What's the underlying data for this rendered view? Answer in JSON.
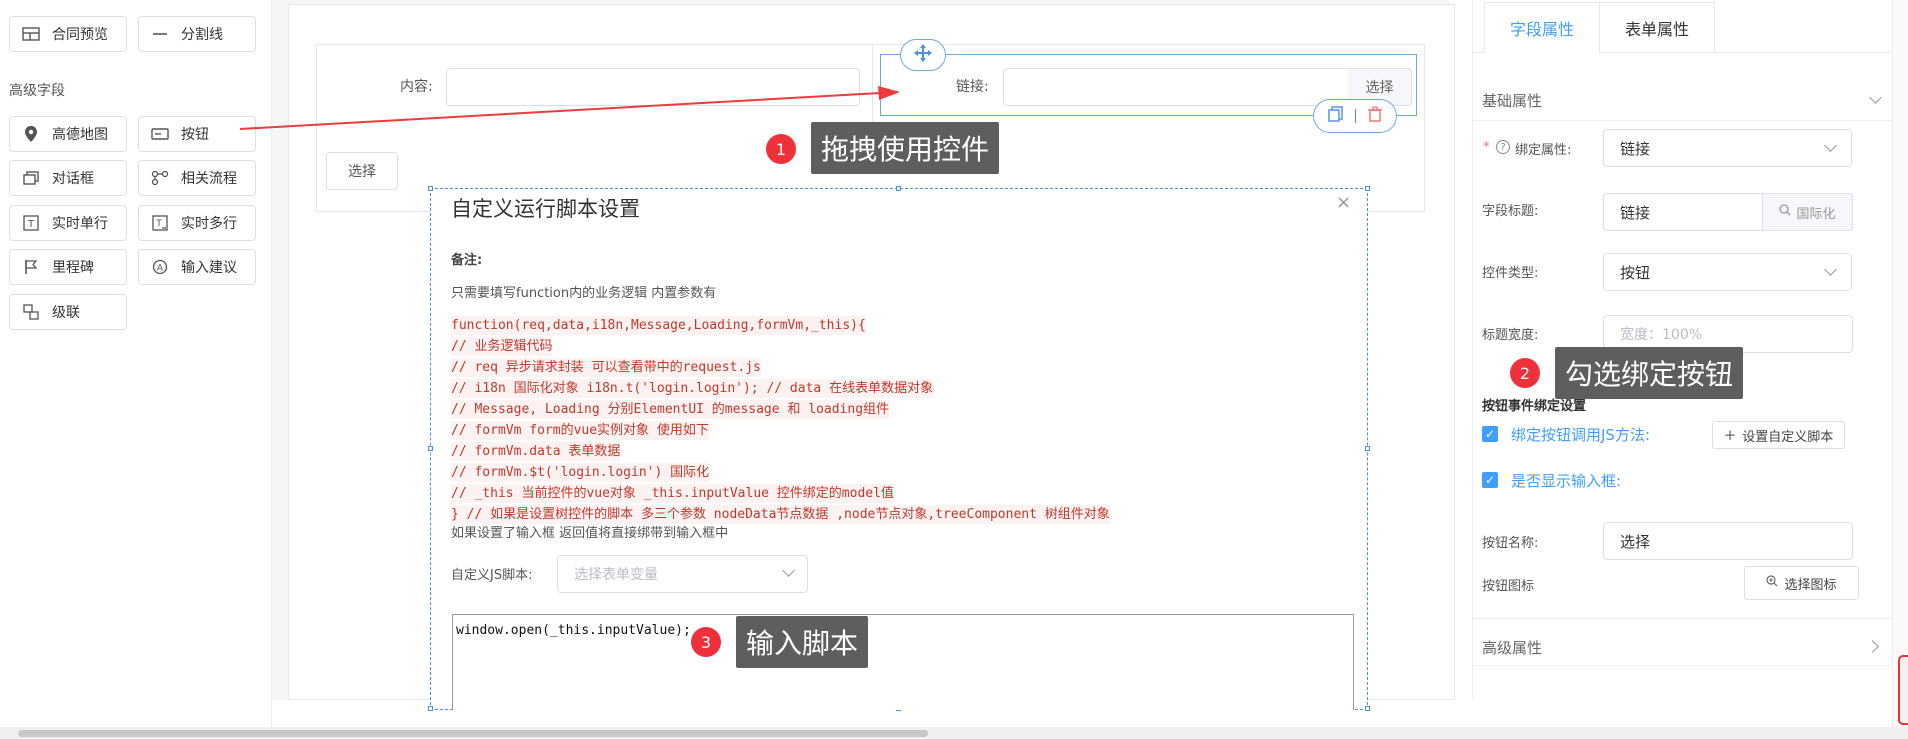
{
  "sidebar": {
    "items_top": [
      {
        "label": "合同预览",
        "icon": "table-icon"
      },
      {
        "label": "分割线",
        "icon": "divider-icon"
      }
    ],
    "section_title": "高级字段",
    "items": [
      {
        "label": "高德地图",
        "icon": "map-pin-icon"
      },
      {
        "label": "按钮",
        "icon": "button-icon"
      },
      {
        "label": "对话框",
        "icon": "dialog-icon"
      },
      {
        "label": "相关流程",
        "icon": "flow-icon"
      },
      {
        "label": "实时单行",
        "icon": "text-single-icon"
      },
      {
        "label": "实时多行",
        "icon": "text-multi-icon"
      },
      {
        "label": "里程碑",
        "icon": "flag-icon"
      },
      {
        "label": "输入建议",
        "icon": "suggest-icon"
      },
      {
        "label": "级联",
        "icon": "cascade-icon"
      }
    ]
  },
  "canvas": {
    "content_label": "内容:",
    "link_label": "链接:",
    "select_btn": "选择",
    "select_btn2": "选择"
  },
  "dialog": {
    "title": "自定义运行脚本设置",
    "close": "×",
    "note_label": "备注:",
    "note_text": "只需要填写function内的业务逻辑 内置参数有",
    "code_lines": [
      "function(req,data,i18n,Message,Loading,formVm,_this){",
      "// 业务逻辑代码",
      "// req 异步请求封装 可以查看带中的request.js",
      "// i18n 国际化对象 i18n.t('login.login'); // data 在线表单数据对象",
      "// Message, Loading 分别ElementUI 的message 和 loading组件",
      "// formVm form的vue实例对象 使用如下",
      "// formVm.data 表单数据",
      "// formVm.$t('login.login') 国际化",
      "// _this 当前控件的vue对象 _this.inputValue 控件绑定的model值",
      "} // 如果是设置树控件的脚本 多三个参数 nodeData节点数据 ,node节点对象,treeComponent 树组件对象"
    ],
    "after_code": "如果设置了输入框 返回值将直接绑带到输入框中",
    "js_label": "自定义JS脚本:",
    "js_placeholder": "选择表单变量",
    "script": "window.open(_this.inputValue);"
  },
  "annotations": [
    {
      "num": "1",
      "text": "拖拽使用控件"
    },
    {
      "num": "2",
      "text": "勾选绑定按钮"
    },
    {
      "num": "3",
      "text": "输入脚本"
    }
  ],
  "panel": {
    "tabs": [
      "字段属性",
      "表单属性"
    ],
    "basic_title": "基础属性",
    "bind_label": "绑定属性:",
    "bind_value": "链接",
    "field_title_label": "字段标题:",
    "field_title_value": "链接",
    "i18n_btn": "国际化",
    "ctrl_type_label": "控件类型:",
    "ctrl_type_value": "按钮",
    "title_width_label": "标题宽度:",
    "title_width_ph": "宽度：100%",
    "event_title": "按钮事件绑定设置",
    "bind_js_label": "绑定按钮调用JS方法:",
    "set_script_btn": "设置自定义脚本",
    "show_input_label": "是否显示输入框:",
    "btn_name_label": "按钮名称:",
    "btn_name_value": "选择",
    "btn_icon_label": "按钮图标",
    "select_icon_btn": "选择图标",
    "advanced_title": "高级属性"
  },
  "colors": {
    "accent": "#409eff",
    "red": "#f0303a",
    "tip": "#5e5e5e"
  }
}
